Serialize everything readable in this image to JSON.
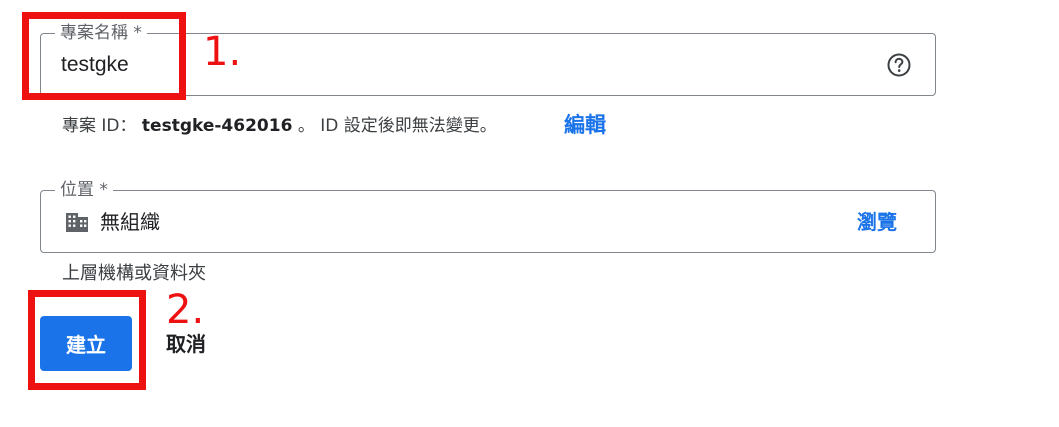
{
  "project_name_field": {
    "label": "專案名稱 *",
    "value": "testgke",
    "help_icon": "help-circle-icon"
  },
  "project_id_line": {
    "prefix": "專案 ID：",
    "project_id": "testgke-462016",
    "suffix": "。 ID 設定後即無法變更。",
    "edit_label": "編輯"
  },
  "location_field": {
    "label": "位置 *",
    "icon": "organization-icon",
    "value": "無組織",
    "browse_label": "瀏覽",
    "hint": "上層機構或資料夾"
  },
  "actions": {
    "create_label": "建立",
    "cancel_label": "取消"
  },
  "annotations": {
    "step1": "1.",
    "step2": "2.",
    "color": "#ee1111"
  },
  "colors": {
    "primary": "#1a73e8",
    "border": "#80868b"
  }
}
